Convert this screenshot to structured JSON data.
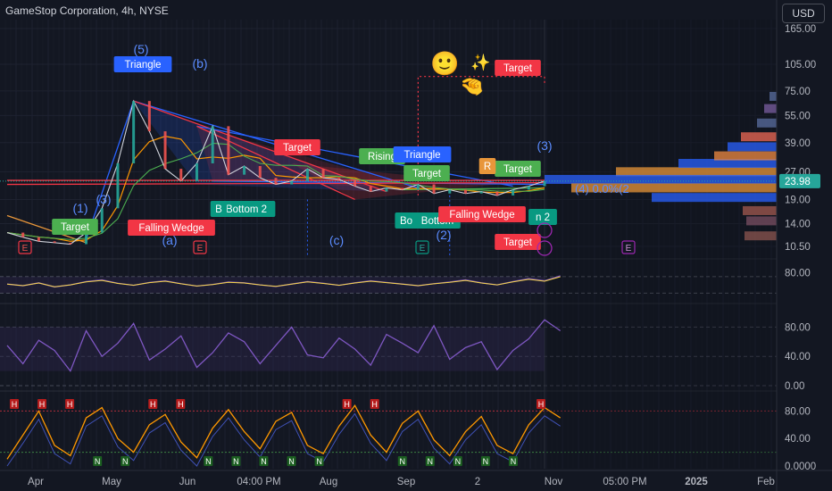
{
  "header": {
    "title": "GameStop Corporation, 4h, NYSE",
    "currency": "USD"
  },
  "chart_data": {
    "type": "line",
    "title": "GameStop Corporation, 4h, NYSE",
    "colors": {
      "background": "#131722",
      "up": "#26a69a",
      "down": "#ef5350",
      "rsi": "#7e57c2",
      "stoch": "#ff9800",
      "pattern_blue": "#2962ff",
      "pattern_red": "#f23645",
      "pattern_green": "#4caf50"
    },
    "price_axis": {
      "scale": "log",
      "ticks": [
        "165.00",
        "105.00",
        "75.00",
        "55.00",
        "39.00",
        "27.00",
        "19.00",
        "14.00",
        "10.50"
      ],
      "last_price": "23.98"
    },
    "time_axis": {
      "ticks": [
        "Apr",
        "May",
        "Jun",
        "04:00 PM",
        "Aug",
        "Sep",
        "2",
        "Nov",
        "05:00 PM",
        "2025",
        "Feb"
      ]
    },
    "price_series": {
      "name": "GME",
      "points": [
        [
          "Apr",
          12.5
        ],
        [
          "Apr",
          11.8
        ],
        [
          "Apr",
          11.2
        ],
        [
          "Apr",
          11.0
        ],
        [
          "May",
          10.8
        ],
        [
          "May",
          12.5
        ],
        [
          "May",
          17.0
        ],
        [
          "May",
          30.0
        ],
        [
          "May",
          66.0
        ],
        [
          "May",
          45.0
        ],
        [
          "May",
          28.0
        ],
        [
          "May",
          24.0
        ],
        [
          "Jun",
          30.0
        ],
        [
          "Jun",
          48.0
        ],
        [
          "Jun",
          26.0
        ],
        [
          "Jun",
          29.0
        ],
        [
          "Jun",
          25.0
        ],
        [
          "Jun",
          23.0
        ],
        [
          "Jul",
          24.0
        ],
        [
          "Jul",
          28.0
        ],
        [
          "Jul",
          25.0
        ],
        [
          "Aug",
          24.5
        ],
        [
          "Aug",
          22.5
        ],
        [
          "Aug",
          21.0
        ],
        [
          "Aug",
          22.0
        ],
        [
          "Sep",
          21.5
        ],
        [
          "Sep",
          23.0
        ],
        [
          "Sep",
          20.5
        ],
        [
          "Sep",
          21.5
        ],
        [
          "Oct",
          20.5
        ],
        [
          "Oct",
          21.0
        ],
        [
          "Oct",
          20.0
        ],
        [
          "Oct",
          21.5
        ],
        [
          "Oct",
          22.5
        ],
        [
          "Oct",
          23.98
        ]
      ]
    },
    "pattern_labels": [
      "Triangle",
      "Falling Wedge",
      "Target",
      "Target",
      "Target",
      "Target",
      "Target",
      "Target",
      "Bottom 2",
      "B",
      "Rising",
      "Triangle",
      "Bottom",
      "Bo",
      "Falling Wedge",
      "R",
      "n 2"
    ],
    "wave_labels": [
      "(5)",
      "(b)",
      "(1)",
      "(3)",
      "(a)",
      "(c)",
      "(2)",
      "(3)"
    ],
    "earnings_markers": [
      "E",
      "E",
      "E",
      "E"
    ],
    "volume_profile": {
      "note_text": "(4) 0.0%(2"
    },
    "rsi": {
      "ticks": [
        "80.00"
      ],
      "values": [
        52,
        48,
        55,
        45,
        50,
        58,
        62,
        54,
        49,
        56,
        60,
        53,
        47,
        51,
        57,
        55,
        50,
        46,
        52,
        58,
        54,
        49,
        55,
        60,
        56,
        52,
        48,
        53,
        57,
        62,
        55,
        50,
        58,
        65,
        60,
        72
      ]
    },
    "stoch_rsi": {
      "ticks": [
        "80.00",
        "40.00",
        "0.00"
      ],
      "values": [
        55,
        30,
        62,
        48,
        20,
        75,
        40,
        58,
        85,
        35,
        50,
        68,
        25,
        45,
        72,
        60,
        30,
        55,
        80,
        42,
        38,
        65,
        50,
        28,
        70,
        58,
        45,
        82,
        36,
        52,
        60,
        22,
        48,
        64,
        90,
        75
      ]
    },
    "oscillator": {
      "ticks": [
        "80.00",
        "40.00",
        "0.0000"
      ],
      "values": [
        10,
        45,
        80,
        30,
        15,
        70,
        85,
        40,
        20,
        60,
        75,
        35,
        12,
        55,
        82,
        50,
        25,
        65,
        78,
        30,
        18,
        58,
        88,
        45,
        20,
        62,
        80,
        38,
        15,
        50,
        72,
        30,
        18,
        60,
        85,
        70
      ],
      "markers": [
        "H",
        "H",
        "H",
        "N",
        "N",
        "H",
        "H",
        "N",
        "N",
        "N",
        "N",
        "N",
        "H",
        "H",
        "N",
        "N",
        "N",
        "N",
        "N",
        "H"
      ]
    }
  }
}
